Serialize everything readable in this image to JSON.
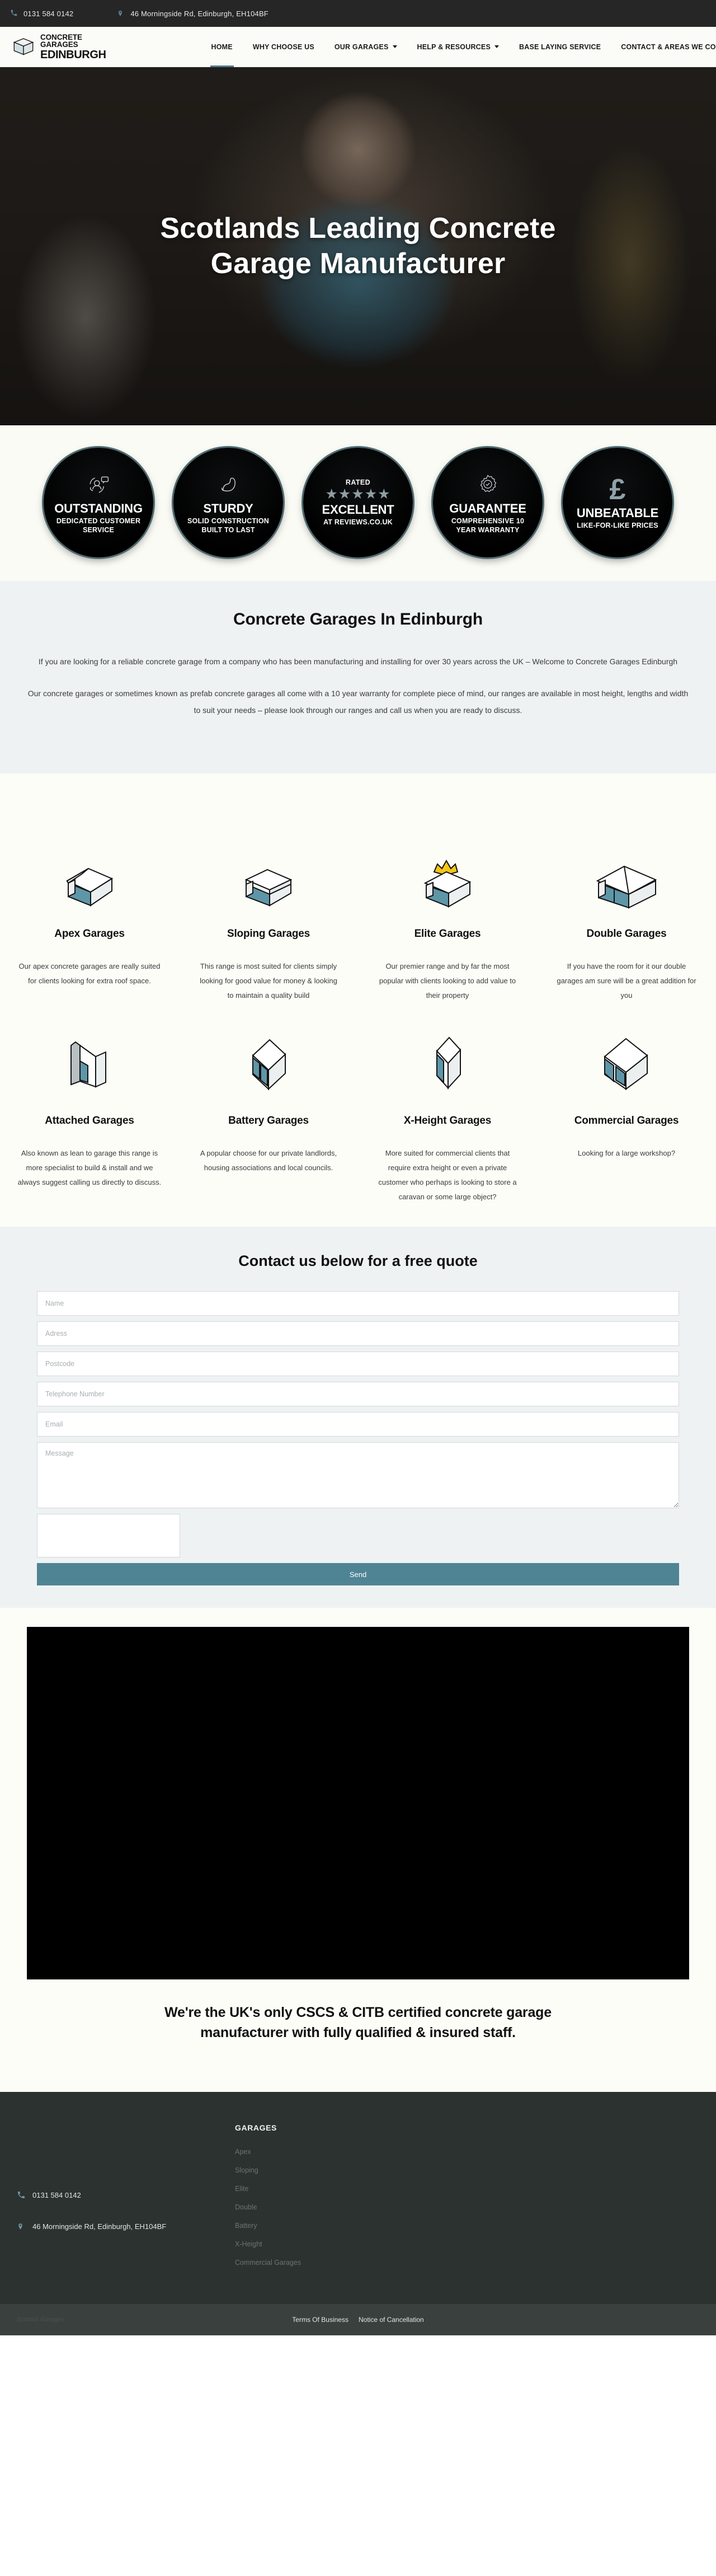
{
  "topbar": {
    "phone": "0131 584 0142",
    "address": "46 Morningside Rd, Edinburgh, EH104BF",
    "phone_icon": "phone-icon",
    "pin_icon": "map-pin-icon"
  },
  "brand": {
    "line1": "CONCRETE GARAGES",
    "line2": "EDINBURGH",
    "logo_icon": "garage-cube-logo-icon"
  },
  "nav": {
    "items": [
      {
        "label": "HOME",
        "active": true,
        "caret": false
      },
      {
        "label": "WHY CHOOSE US",
        "active": false,
        "caret": false
      },
      {
        "label": "OUR GARAGES",
        "active": false,
        "caret": true
      },
      {
        "label": "HELP & RESOURCES",
        "active": false,
        "caret": true
      },
      {
        "label": "BASE LAYING SERVICE",
        "active": false,
        "caret": false
      },
      {
        "label": "CONTACT & AREAS WE COVER",
        "active": false,
        "caret": false
      }
    ]
  },
  "hero": {
    "title_line1": "Scotlands Leading Concrete",
    "title_line2": "Garage Manufacturer"
  },
  "badges": [
    {
      "icon": "customer-service-icon",
      "pre": "",
      "title": "OUTSTANDING",
      "sub": "DEDICATED CUSTOMER SERVICE"
    },
    {
      "icon": "flexed-bicep-icon",
      "pre": "",
      "title": "STURDY",
      "sub": "SOLID CONSTRUCTION BUILT TO LAST"
    },
    {
      "icon": "five-stars-icon",
      "pre": "RATED",
      "stars": "★★★★★",
      "title": "EXCELLENT",
      "sub": "AT REVIEWS.CO.UK"
    },
    {
      "icon": "certified-rosette-icon",
      "pre": "",
      "title": "GUARANTEE",
      "sub": "COMPREHENSIVE 10 YEAR WARRANTY"
    },
    {
      "icon": "pound-sterling-icon",
      "pre": "",
      "glyph": "£",
      "title": "UNBEATABLE",
      "sub": "LIKE-FOR-LIKE PRICES"
    }
  ],
  "intro": {
    "heading": "Concrete Garages In Edinburgh",
    "p1": "If you are looking for a reliable concrete garage from a company who has been manufacturing and installing for over 30 years across the UK – Welcome to Concrete Garages Edinburgh",
    "p2": "Our concrete garages or sometimes known as prefab concrete garages all come with a 10 year warranty for complete piece of mind, our ranges are available in most height, lengths and width to suit your needs – please look through our ranges and call us when you are ready to discuss."
  },
  "products": {
    "row1": [
      {
        "icon": "apex-garage-icon",
        "title": "Apex Garages",
        "desc": "Our apex concrete garages are really suited for clients looking for extra roof space."
      },
      {
        "icon": "sloping-garage-icon",
        "title": "Sloping Garages",
        "desc": "This range is most suited for clients simply looking for good value for money & looking to maintain a quality build"
      },
      {
        "icon": "elite-garage-crown-icon",
        "title": "Elite Garages",
        "desc": "Our premier range and by far the most popular with clients looking to add value to their property"
      },
      {
        "icon": "double-garage-icon",
        "title": "Double Garages",
        "desc": "If you have the room for it our double garages am sure will be a great addition for you"
      }
    ],
    "row2": [
      {
        "icon": "attached-garage-icon",
        "title": "Attached Garages",
        "desc": "Also known as lean to garage this range is more specialist to build & install and we always suggest calling us directly to discuss."
      },
      {
        "icon": "battery-garage-icon",
        "title": "Battery Garages",
        "desc": "A popular choose for our private landlords, housing associations and local councils."
      },
      {
        "icon": "x-height-garage-icon",
        "title": "X-Height Garages",
        "desc": "More suited for commercial clients that require extra height or even a private customer who perhaps is looking to store a caravan or some large object?"
      },
      {
        "icon": "commercial-garage-icon",
        "title": "Commercial Garages",
        "desc": "Looking for a large workshop?"
      }
    ]
  },
  "form": {
    "heading": "Contact us below for a free quote",
    "fields": [
      {
        "name": "name",
        "placeholder": "Name",
        "value": ""
      },
      {
        "name": "address",
        "placeholder": "Adress",
        "value": ""
      },
      {
        "name": "postcode",
        "placeholder": "Postcode",
        "value": ""
      },
      {
        "name": "telephone",
        "placeholder": "Telephone Number",
        "value": ""
      },
      {
        "name": "email",
        "placeholder": "Email",
        "value": ""
      }
    ],
    "message_placeholder": "Message",
    "message_value": "",
    "send_label": "Send"
  },
  "cscs": {
    "line1": "We're the UK's only CSCS & CITB certified concrete garage",
    "line2": "manufacturer with fully qualified & insured staff."
  },
  "footer": {
    "phone": "0131 584 0142",
    "address": "46 Morningside Rd, Edinburgh, EH104BF",
    "garages_heading": "GARAGES",
    "garages_links": [
      "Apex",
      "Sloping",
      "Elite",
      "Double",
      "Battery",
      "X-Height",
      "Commercial Garages"
    ]
  },
  "bottombar": {
    "left": "Scottish Garages",
    "links": [
      "Terms Of Business",
      "Notice of Cancellation"
    ]
  },
  "colors": {
    "accent": "#4f8494",
    "topbar_bg": "#262626",
    "footer_bg": "#2c3230",
    "intro_bg": "#eef2f3"
  }
}
